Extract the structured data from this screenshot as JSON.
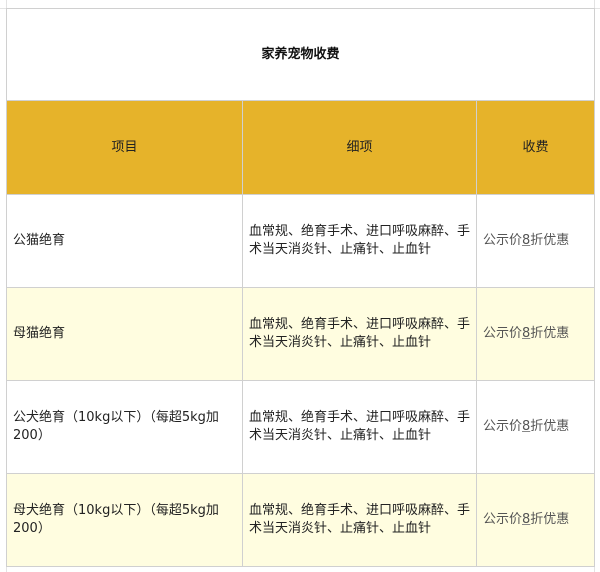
{
  "table": {
    "title": "家养宠物收费",
    "header_bg": "#e6b32a",
    "alt_row_bg": "#fffde0",
    "headers": [
      "项目",
      "细项",
      "收费"
    ],
    "rows": [
      {
        "item": "公猫绝育",
        "detail": "血常规、绝育手术、进口呼吸麻醉、手术当天消炎针、止痛针、止血针",
        "fee_prefix": "公示价",
        "fee_number": "8",
        "fee_suffix": "折优惠"
      },
      {
        "item": "母猫绝育",
        "detail": "血常规、绝育手术、进口呼吸麻醉、手术当天消炎针、止痛针、止血针",
        "fee_prefix": "公示价",
        "fee_number": "8",
        "fee_suffix": "折优惠"
      },
      {
        "item": "公犬绝育（10kg以下）（每超5kg加200）",
        "detail": "血常规、绝育手术、进口呼吸麻醉、手术当天消炎针、止痛针、止血针",
        "fee_prefix": "公示价",
        "fee_number": "8",
        "fee_suffix": "折优惠"
      },
      {
        "item": "母犬绝育（10kg以下）（每超5kg加200）",
        "detail": "血常规、绝育手术、进口呼吸麻醉、手术当天消炎针、止痛针、止血针",
        "fee_prefix": "公示价",
        "fee_number": "8",
        "fee_suffix": "折优惠"
      }
    ]
  }
}
